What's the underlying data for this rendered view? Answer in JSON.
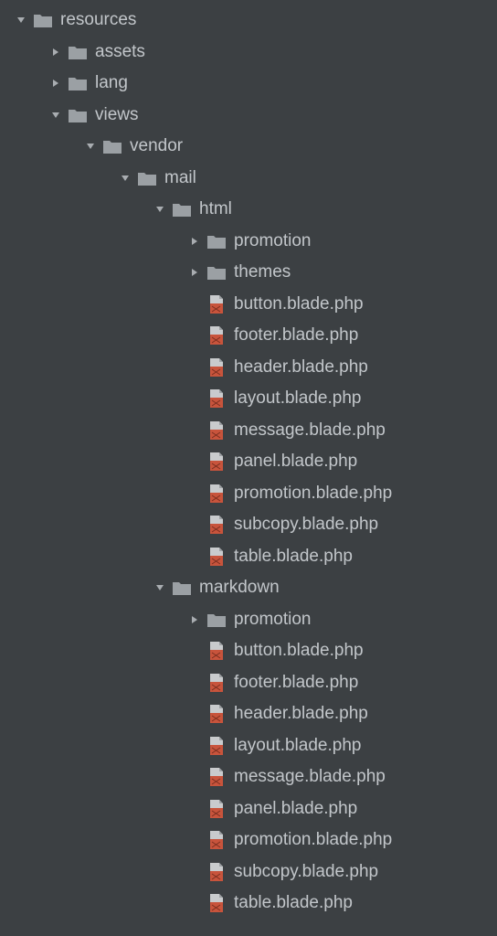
{
  "tree": [
    {
      "depth": 0,
      "type": "folder",
      "state": "open",
      "label": "resources"
    },
    {
      "depth": 1,
      "type": "folder",
      "state": "closed",
      "label": "assets"
    },
    {
      "depth": 1,
      "type": "folder",
      "state": "closed",
      "label": "lang"
    },
    {
      "depth": 1,
      "type": "folder",
      "state": "open",
      "label": "views"
    },
    {
      "depth": 2,
      "type": "folder",
      "state": "open",
      "label": "vendor"
    },
    {
      "depth": 3,
      "type": "folder",
      "state": "open",
      "label": "mail"
    },
    {
      "depth": 4,
      "type": "folder",
      "state": "open",
      "label": "html"
    },
    {
      "depth": 5,
      "type": "folder",
      "state": "closed",
      "label": "promotion"
    },
    {
      "depth": 5,
      "type": "folder",
      "state": "closed",
      "label": "themes"
    },
    {
      "depth": 5,
      "type": "file",
      "state": "none",
      "label": "button.blade.php"
    },
    {
      "depth": 5,
      "type": "file",
      "state": "none",
      "label": "footer.blade.php"
    },
    {
      "depth": 5,
      "type": "file",
      "state": "none",
      "label": "header.blade.php"
    },
    {
      "depth": 5,
      "type": "file",
      "state": "none",
      "label": "layout.blade.php"
    },
    {
      "depth": 5,
      "type": "file",
      "state": "none",
      "label": "message.blade.php"
    },
    {
      "depth": 5,
      "type": "file",
      "state": "none",
      "label": "panel.blade.php"
    },
    {
      "depth": 5,
      "type": "file",
      "state": "none",
      "label": "promotion.blade.php"
    },
    {
      "depth": 5,
      "type": "file",
      "state": "none",
      "label": "subcopy.blade.php"
    },
    {
      "depth": 5,
      "type": "file",
      "state": "none",
      "label": "table.blade.php"
    },
    {
      "depth": 4,
      "type": "folder",
      "state": "open",
      "label": "markdown"
    },
    {
      "depth": 5,
      "type": "folder",
      "state": "closed",
      "label": "promotion"
    },
    {
      "depth": 5,
      "type": "file",
      "state": "none",
      "label": "button.blade.php"
    },
    {
      "depth": 5,
      "type": "file",
      "state": "none",
      "label": "footer.blade.php"
    },
    {
      "depth": 5,
      "type": "file",
      "state": "none",
      "label": "header.blade.php"
    },
    {
      "depth": 5,
      "type": "file",
      "state": "none",
      "label": "layout.blade.php"
    },
    {
      "depth": 5,
      "type": "file",
      "state": "none",
      "label": "message.blade.php"
    },
    {
      "depth": 5,
      "type": "file",
      "state": "none",
      "label": "panel.blade.php"
    },
    {
      "depth": 5,
      "type": "file",
      "state": "none",
      "label": "promotion.blade.php"
    },
    {
      "depth": 5,
      "type": "file",
      "state": "none",
      "label": "subcopy.blade.php"
    },
    {
      "depth": 5,
      "type": "file",
      "state": "none",
      "label": "table.blade.php"
    }
  ],
  "colors": {
    "bg": "#3c4043",
    "text": "#c2c6ca",
    "arrow": "#a9adb1",
    "folder": "#9ba0a4",
    "file_bg": "#c9cbcd",
    "file_accent": "#c8543c"
  }
}
